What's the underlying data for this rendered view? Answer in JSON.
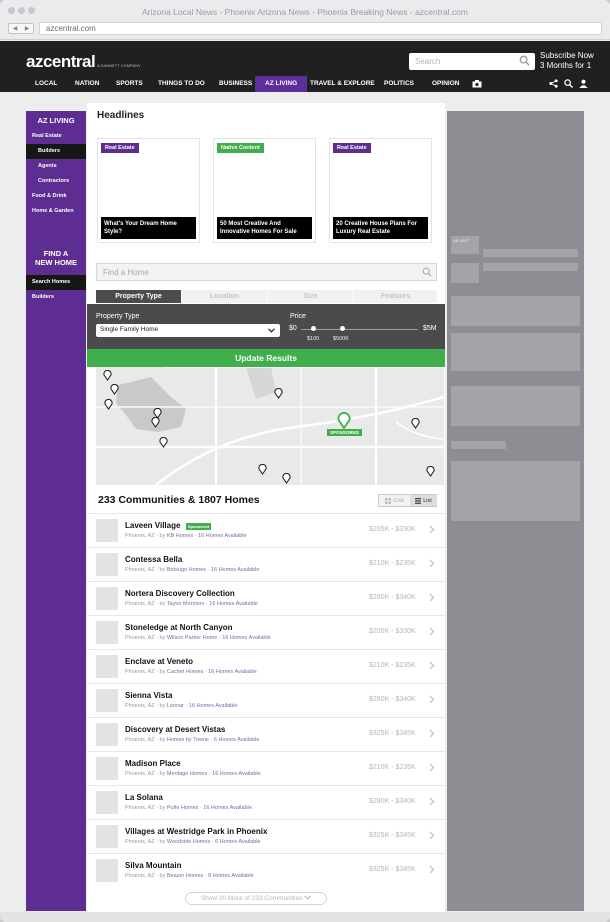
{
  "window": {
    "title": "Arizona Local News - Phoenix Arizona News - Phoenix Breaking News - azcentral.com",
    "url": "azcentral.com"
  },
  "header": {
    "logo": "azcentral",
    "logo_sub": "A GANNETT COMPANY",
    "search_placeholder": "Search",
    "subscribe_line1": "Subscribe Now",
    "subscribe_line2": "3 Months for 1",
    "nav": [
      "LOCAL",
      "NATION",
      "SPORTS",
      "THINGS TO DO",
      "BUSINESS",
      "AZ LIVING",
      "TRAVEL & EXPLORE",
      "POLITICS",
      "OPINION"
    ],
    "active_nav": "AZ LIVING"
  },
  "sidebar": {
    "section_title": "AZ LIVING",
    "items": [
      "Real Estate",
      "Builders",
      "Agents",
      "Contractors",
      "Food & Drink",
      "Home & Garden"
    ],
    "find_title_1": "FIND A",
    "find_title_2": "NEW HOME",
    "find_items": [
      "Search Homes",
      "Builders"
    ]
  },
  "headlines": {
    "title": "Headlines",
    "cards": [
      {
        "tag": "Real Estate",
        "tag_color": "#5d2d92",
        "caption": "What's Your Dream Home Style?"
      },
      {
        "tag": "Native Content",
        "tag_color": "#3fae4b",
        "caption": "50 Most Creative And Innovative Homes For Sale"
      },
      {
        "tag": "Real Estate",
        "tag_color": "#5d2d92",
        "caption": "20 Creative House Plans For Luxury Real Estate"
      }
    ]
  },
  "finder": {
    "placeholder": "Find a Home",
    "tabs": [
      "Property Type",
      "Location",
      "Size",
      "Features"
    ],
    "active_tab": "Property Type",
    "property_type_label": "Property Type",
    "property_type_value": "Single Family Home",
    "price_label": "Price",
    "price_min": "$0",
    "price_max": "$5M",
    "price_low_label": "$100",
    "price_high_label": "$500K",
    "update_label": "Update Results",
    "sponsored_label": "SPONSORED"
  },
  "results": {
    "title": "233 Communities & 1807 Homes",
    "grid_label": "Grid",
    "list_label": "List",
    "sponsored_badge": "Sponsored",
    "more_label": "Show 20 More of 233 Communities",
    "items": [
      {
        "name": "Laveen Village",
        "loc": "Phoenix, AZ · by",
        "builder": "KB Homes",
        "avail": "16 Homes Available",
        "price": "$205K - $330K"
      },
      {
        "name": "Contessa Bella",
        "loc": "Phoenix, AZ · by",
        "builder": "Betsugo Homes",
        "avail": "16 Homes Available",
        "price": "$210K - $235K"
      },
      {
        "name": "Nortera Discovery Collection",
        "loc": "Phoenix, AZ · by",
        "builder": "Taylor Morrison",
        "avail": "16 Homes Available",
        "price": "$280K - $340K"
      },
      {
        "name": "Stoneledge at North Canyon",
        "loc": "Phoenix, AZ · by",
        "builder": "Wilson Parker Home",
        "avail": "16 Homes Available",
        "price": "$205K - $330K"
      },
      {
        "name": "Enclave at Veneto",
        "loc": "Phoenix, AZ · by",
        "builder": "Cachet Homes",
        "avail": "16 Homes Available",
        "price": "$210K - $235K"
      },
      {
        "name": "Sienna Vista",
        "loc": "Phoenix, AZ · by",
        "builder": "Lennar",
        "avail": "16 Homes Available",
        "price": "$280K - $340K"
      },
      {
        "name": "Discovery at Desert Vistas",
        "loc": "Phoenix, AZ · by",
        "builder": "Homes by Towne",
        "avail": "6 Homes Available",
        "price": "$325K - $345K"
      },
      {
        "name": "Madison Place",
        "loc": "Phoenix, AZ · by",
        "builder": "Meritage Homes",
        "avail": "16 Homes Available",
        "price": "$210K - $235K"
      },
      {
        "name": "La Solana",
        "loc": "Phoenix, AZ · by",
        "builder": "Pulte Homes",
        "avail": "16 Homes Available",
        "price": "$280K - $340K"
      },
      {
        "name": "Villages at Westridge Park in Phoenix",
        "loc": "Phoenix, AZ · by",
        "builder": "Woodside Homes",
        "avail": "6 Homes Available",
        "price": "$325K - $345K"
      },
      {
        "name": "Silva Mountain",
        "loc": "Phoenix, AZ · by",
        "builder": "Beazer Homes",
        "avail": "8 Homes Available",
        "price": "$325K - $345K"
      }
    ]
  },
  "ad": {
    "label": "AD UNIT"
  },
  "colors": {
    "purple": "#5d2d92",
    "green": "#3fae4b",
    "dark": "#202020"
  }
}
